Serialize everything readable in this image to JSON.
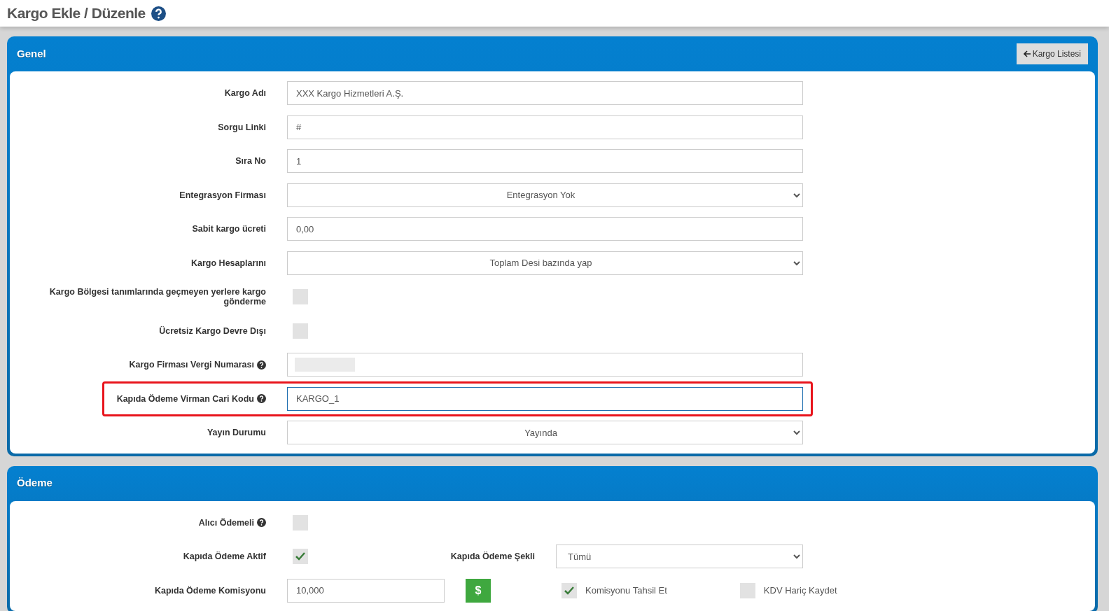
{
  "page_title": {
    "text": "Kargo Ekle / Düzenle",
    "help": true
  },
  "general": {
    "title": "Genel",
    "back_button": "Kargo Listesi",
    "rows": [
      {
        "kind": "text",
        "label": "Kargo Adı",
        "value": "XXX Kargo Hizmetleri A.Ş.",
        "help": false,
        "highlighted": false
      },
      {
        "kind": "text",
        "label": "Sorgu Linki",
        "value": "#",
        "help": false,
        "highlighted": false
      },
      {
        "kind": "text",
        "label": "Sıra No",
        "value": "1",
        "help": false,
        "highlighted": false
      },
      {
        "kind": "select",
        "label": "Entegrasyon Firması",
        "value": "Entegrasyon Yok",
        "help": false,
        "highlighted": false
      },
      {
        "kind": "text",
        "label": "Sabit kargo ücreti",
        "value": "0,00",
        "help": false,
        "highlighted": false
      },
      {
        "kind": "select",
        "label": "Kargo Hesaplarını",
        "value": "Toplam Desi bazında yap",
        "help": false,
        "highlighted": false
      },
      {
        "kind": "checkbox",
        "label": "Kargo Bölgesi tanımlarında geçmeyen yerlere kargo gönderme",
        "checked": false,
        "help": false,
        "highlighted": false
      },
      {
        "kind": "checkbox",
        "label": "Ücretsiz Kargo Devre Dışı",
        "checked": false,
        "help": false,
        "highlighted": false
      },
      {
        "kind": "redacted",
        "label": "Kargo Firması Vergi Numarası",
        "help": true,
        "highlighted": false
      },
      {
        "kind": "text",
        "label": "Kapıda Ödeme Virman Cari Kodu",
        "value": "KARGO_1",
        "help": true,
        "highlighted": true,
        "focused": true
      },
      {
        "kind": "select",
        "label": "Yayın Durumu",
        "value": "Yayında",
        "help": false,
        "highlighted": false
      }
    ]
  },
  "payment": {
    "title": "Ödeme",
    "alici": {
      "label": "Alıcı Ödemeli",
      "help": true,
      "checked": false
    },
    "aktif": {
      "label": "Kapıda Ödeme Aktif",
      "checked": true
    },
    "sekli": {
      "label": "Kapıda Ödeme Şekli",
      "value": "Tümü"
    },
    "komisyon": {
      "label": "Kapıda Ödeme Komisyonu",
      "value": "10,000",
      "button": "$"
    },
    "tahsil": {
      "label": "Komisyonu Tahsil Et",
      "checked": true
    },
    "kdv": {
      "label": "KDV Hariç Kaydet",
      "checked": false
    }
  }
}
